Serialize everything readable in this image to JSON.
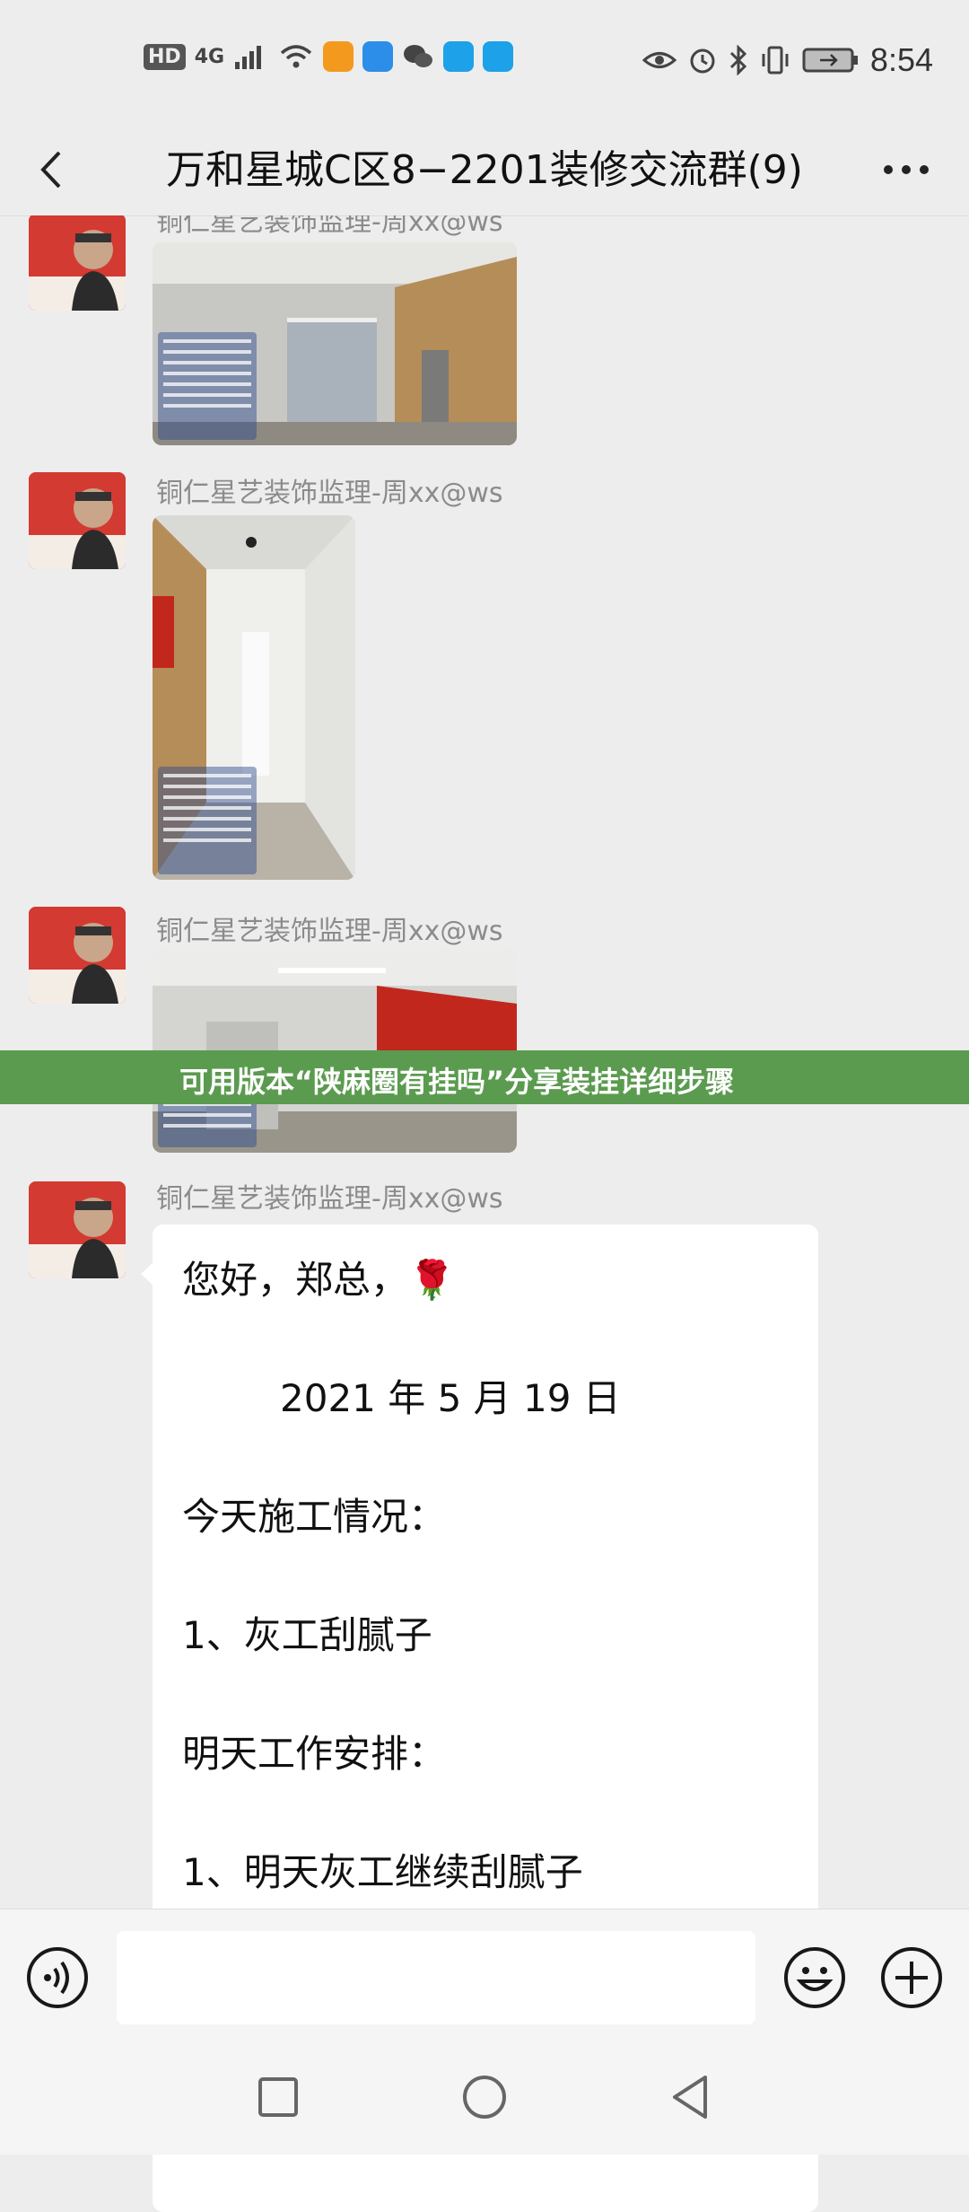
{
  "status_bar": {
    "hd": "HD",
    "network": "4G",
    "time": "8:54",
    "app_icon_colors": [
      "#f39a1e",
      "#2c8ee8",
      "#444444",
      "#1da1e8",
      "#1da1e8"
    ]
  },
  "header": {
    "title": "万和星城C区8−2201装修交流群(9)",
    "back_icon": "chevron-left-icon",
    "more_icon": "more-dots-icon"
  },
  "messages": [
    {
      "sender": "铜仁星艺装饰监理-周xx@ws",
      "type": "image"
    },
    {
      "sender": "铜仁星艺装饰监理-周xx@ws",
      "type": "image"
    },
    {
      "sender": "铜仁星艺装饰监理-周xx@ws",
      "type": "image"
    },
    {
      "sender": "铜仁星艺装饰监理-周xx@ws",
      "type": "text",
      "lines": [
        "您好，郑总，🌹",
        "2021 年 5 月 19 日",
        "今天施工情况：",
        "1、灰工刮腻子",
        "明天工作安排：",
        "1、明天灰工继续刮腻子"
      ]
    }
  ],
  "banner": {
    "text": "可用版本“陕麻圈有挂吗”分享装挂详细步骤",
    "color": "#5b9b4f"
  },
  "input_bar": {
    "text_value": "",
    "voice_icon": "voice-icon",
    "emoji_icon": "emoji-icon",
    "plus_icon": "plus-icon"
  },
  "nav_bar": {
    "icons": [
      "recents-square-icon",
      "home-circle-icon",
      "back-triangle-icon"
    ]
  }
}
